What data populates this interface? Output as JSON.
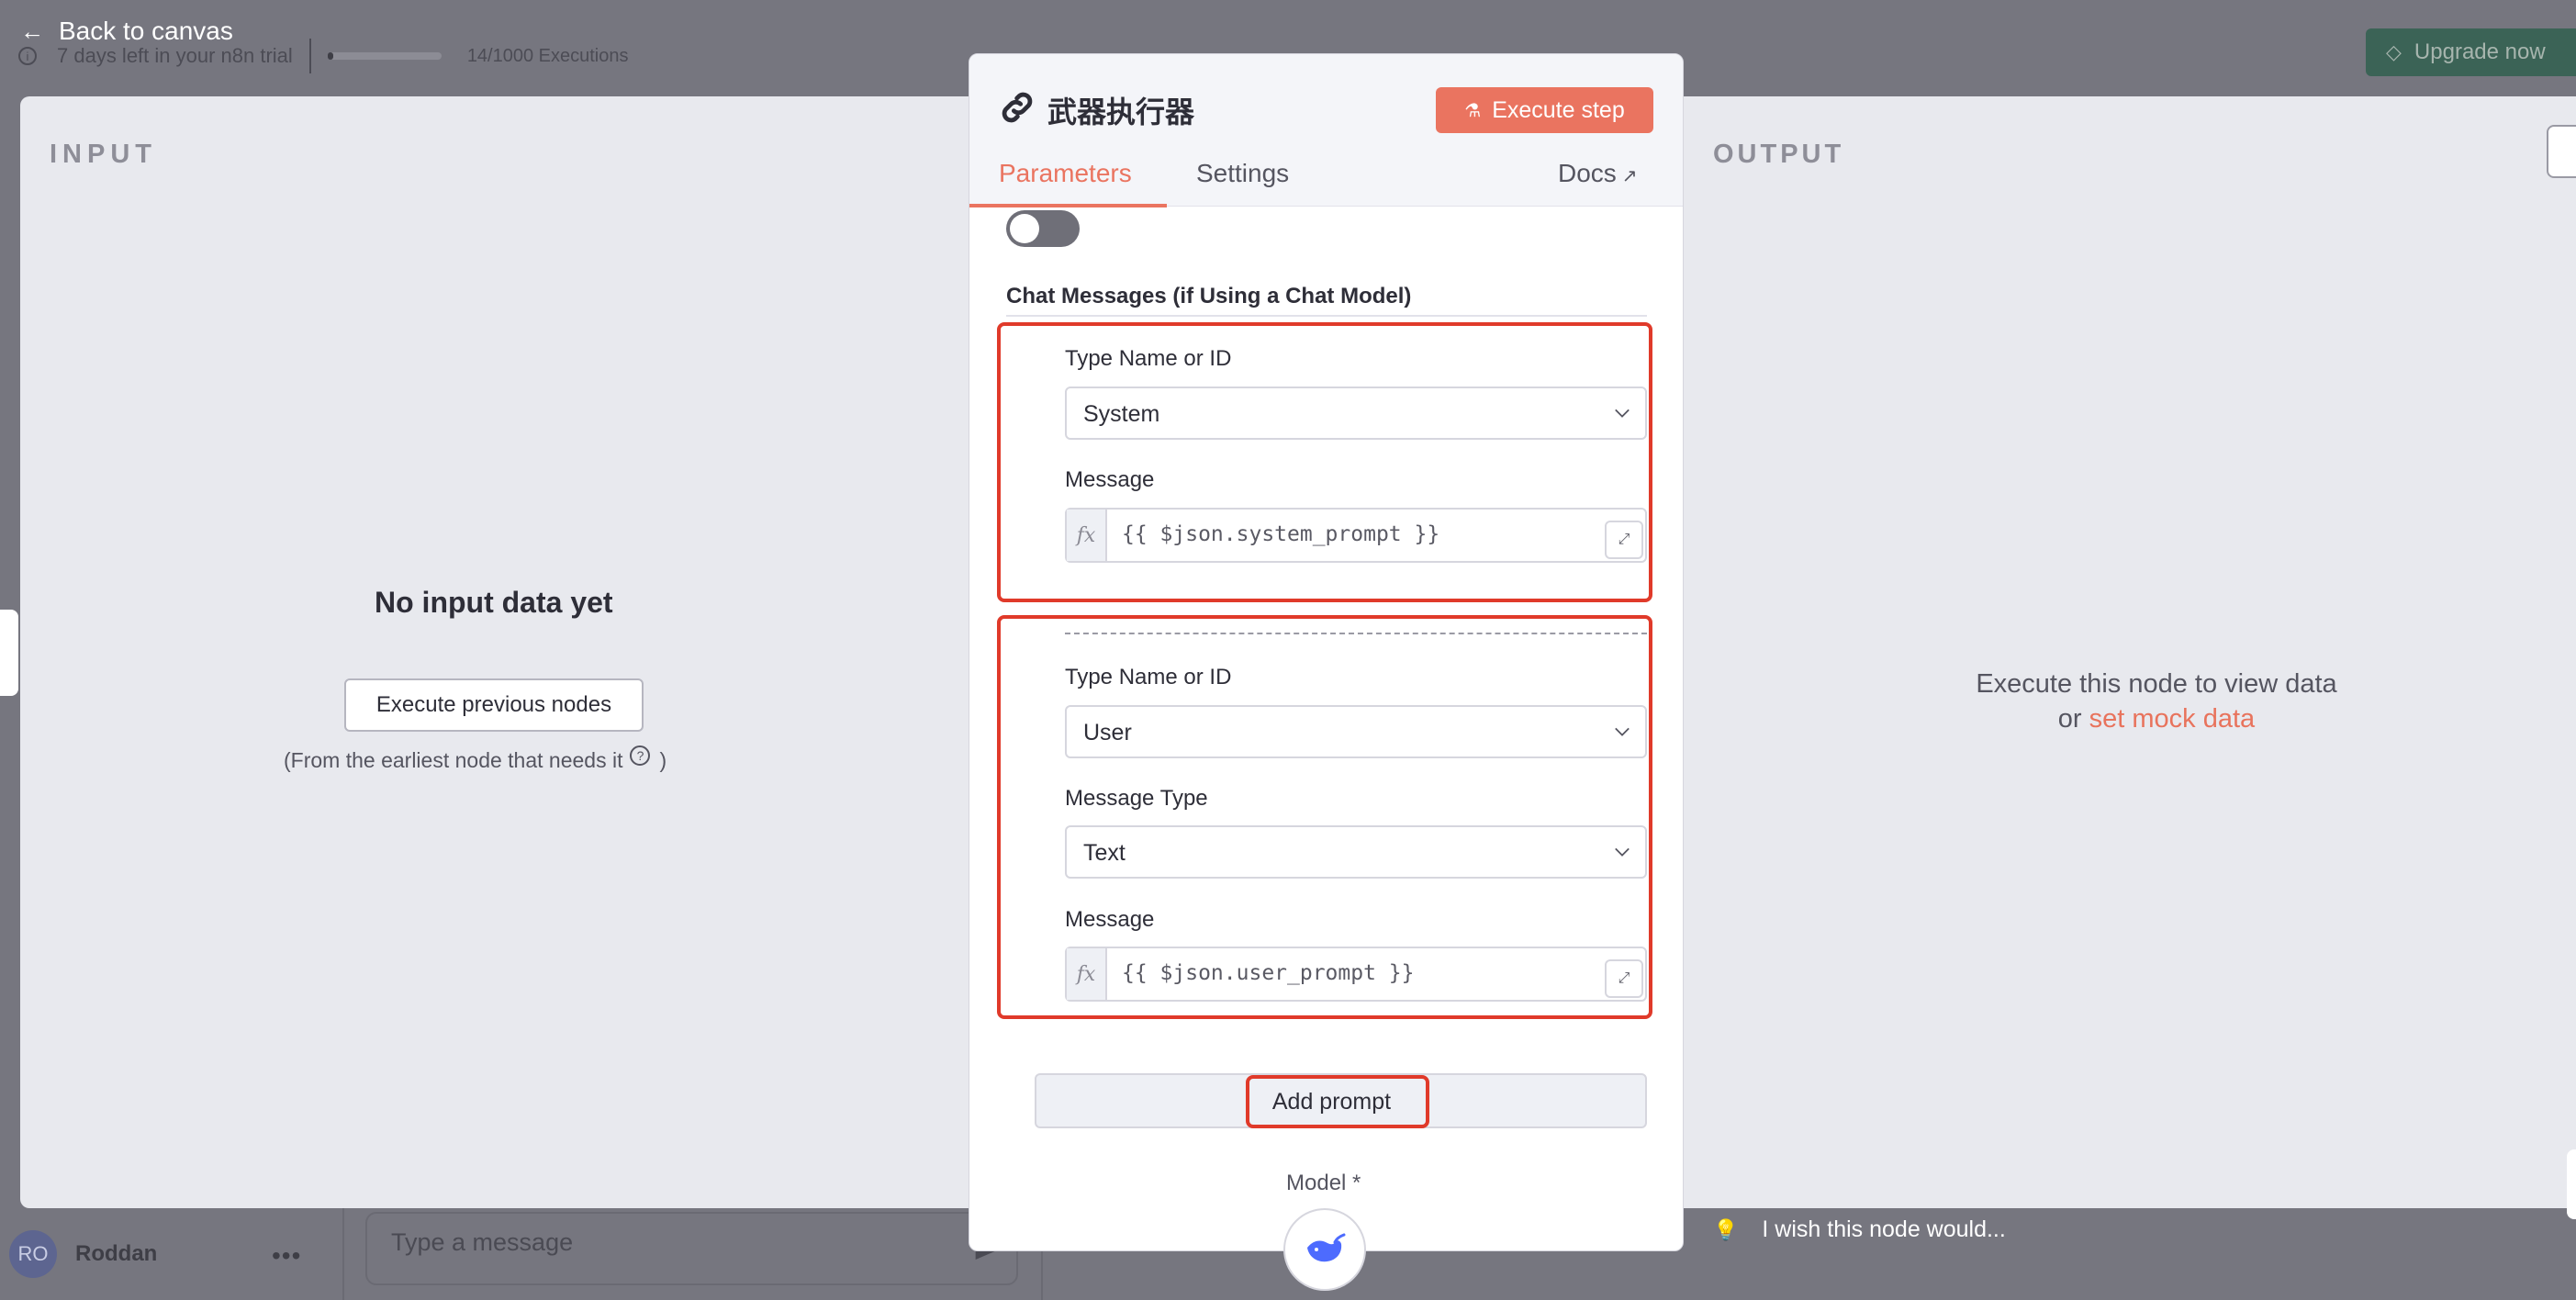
{
  "topbar": {
    "back_label": "Back to canvas",
    "trial_text": "7 days left in your n8n trial",
    "executions_text": "14/1000 Executions",
    "executions_progress": 0.014,
    "upgrade_label": "Upgrade now"
  },
  "input_panel": {
    "title": "INPUT",
    "empty_title": "No input data yet",
    "execute_previous_label": "Execute previous nodes",
    "note_before": "(From the earliest node that needs it",
    "note_after": ")"
  },
  "output_panel": {
    "title": "OUTPUT",
    "line1": "Execute this node to view data",
    "line2_prefix": "or",
    "mock_link": "set mock data"
  },
  "node": {
    "name": "武器执行器",
    "execute_label": "Execute step",
    "tabs": {
      "parameters": "Parameters",
      "settings": "Settings",
      "docs": "Docs"
    },
    "section_title": "Chat Messages (if Using a Chat Model)",
    "messages": [
      {
        "type_label": "Type Name or ID",
        "type_value": "System",
        "message_label": "Message",
        "message_value": "{{ $json.system_prompt }}"
      },
      {
        "type_label": "Type Name or ID",
        "type_value": "User",
        "message_type_label": "Message Type",
        "message_type_value": "Text",
        "message_label": "Message",
        "message_value": "{{ $json.user_prompt }}"
      }
    ],
    "add_prompt_label": "Add prompt",
    "model_label": "Model *"
  },
  "bottom": {
    "user_initials": "RO",
    "user_name": "Roddan",
    "chat_placeholder": "Type a message",
    "hint": "I wish this node would..."
  },
  "colors": {
    "accent": "#ea7460",
    "highlight": "#e03a2a",
    "upgrade_bg": "#3b6356"
  }
}
